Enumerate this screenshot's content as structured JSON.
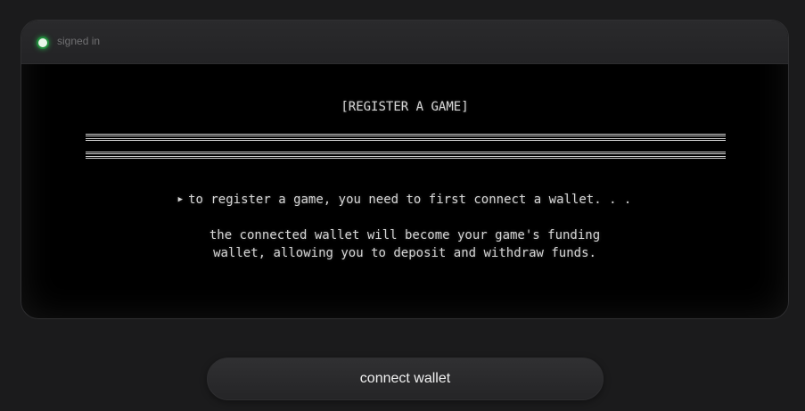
{
  "status": {
    "label": "signed in",
    "color": "#1f8a3a"
  },
  "terminal": {
    "heading": "[REGISTER A GAME]",
    "prompt_icon": "triangle-right-icon",
    "prompt": "to register a game, you need to first connect a wallet. . .",
    "description_line1": "the connected wallet will become your game's funding",
    "description_line2": "wallet, allowing you to deposit and withdraw funds."
  },
  "actions": {
    "connect_label": "connect wallet"
  }
}
